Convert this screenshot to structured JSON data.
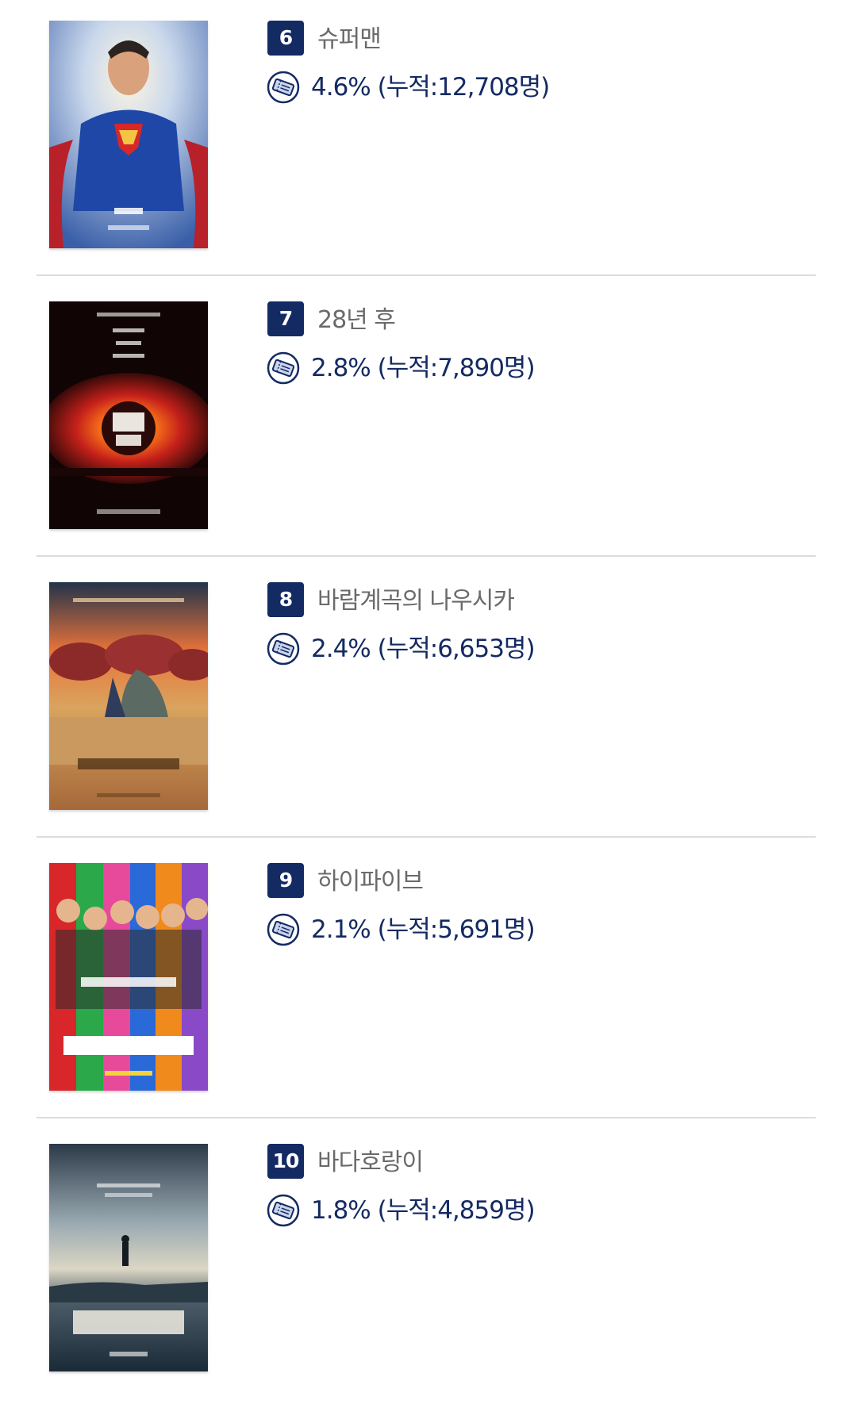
{
  "rankings": [
    {
      "rank": "6",
      "title": "슈퍼맨",
      "stat": "4.6% (누적:12,708명)",
      "poster_icon": "superman-poster"
    },
    {
      "rank": "7",
      "title": "28년 후",
      "stat": "2.8% (누적:7,890명)",
      "poster_icon": "28-years-later-poster"
    },
    {
      "rank": "8",
      "title": "바람계곡의 나우시카",
      "stat": "2.4% (누적:6,653명)",
      "poster_icon": "nausicaa-poster"
    },
    {
      "rank": "9",
      "title": "하이파이브",
      "stat": "2.1% (누적:5,691명)",
      "poster_icon": "hi-five-poster"
    },
    {
      "rank": "10",
      "title": "바다호랑이",
      "stat": "1.8% (누적:4,859명)",
      "poster_icon": "sea-tiger-poster"
    }
  ],
  "colors": {
    "badge_bg": "#142a63",
    "stat_text": "#142a63",
    "title_text": "#6a6a6a",
    "divider": "#dcdcdc"
  },
  "icons": {
    "ticket": "ticket-icon"
  }
}
